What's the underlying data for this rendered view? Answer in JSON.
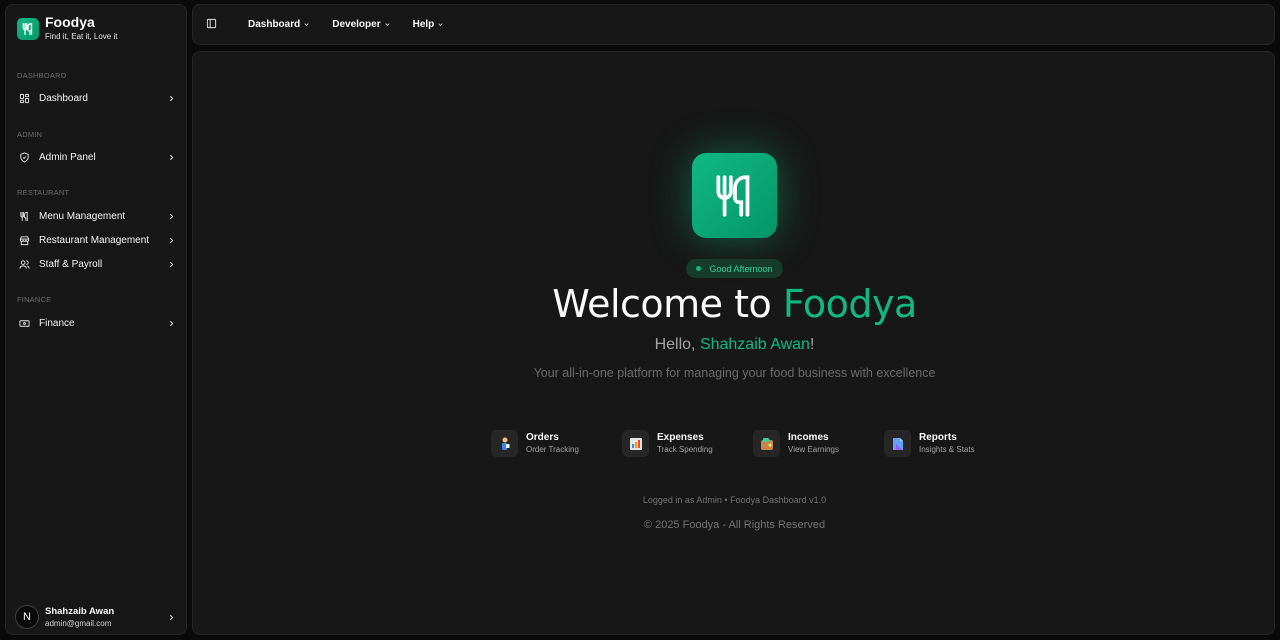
{
  "brand": {
    "name": "Foodya",
    "tagline": "Find it, Eat it, Love it",
    "accent": "#10b981"
  },
  "sidebar": {
    "groups": [
      {
        "label": "DASHBOARD",
        "items": [
          {
            "label": "Dashboard",
            "icon": "grid-icon"
          }
        ]
      },
      {
        "label": "ADMIN",
        "items": [
          {
            "label": "Admin Panel",
            "icon": "shield-check-icon"
          }
        ]
      },
      {
        "label": "RESTAURANT",
        "items": [
          {
            "label": "Menu Management",
            "icon": "utensils-icon"
          },
          {
            "label": "Restaurant Management",
            "icon": "store-icon"
          },
          {
            "label": "Staff & Payroll",
            "icon": "users-icon"
          }
        ]
      },
      {
        "label": "FINANCE",
        "items": [
          {
            "label": "Finance",
            "icon": "banknote-icon"
          }
        ]
      }
    ],
    "user": {
      "avatar": "N",
      "name": "Shahzaib Awan",
      "email": "admin@gmail.com"
    }
  },
  "topbar": {
    "menus": [
      {
        "label": "Dashboard"
      },
      {
        "label": "Developer"
      },
      {
        "label": "Help"
      }
    ]
  },
  "main": {
    "greeting_badge": "Good Afternoon",
    "welcome_prefix": "Welcome to ",
    "welcome_brand": "Foodya",
    "hello_prefix": "Hello, ",
    "hello_name": "Shahzaib Awan",
    "hello_suffix": "!",
    "subtitle": "Your all-in-one platform for managing your food business with excellence",
    "features": [
      {
        "title": "Orders",
        "subtitle": "Order Tracking",
        "icon": "orders-icon"
      },
      {
        "title": "Expenses",
        "subtitle": "Track Spending",
        "icon": "expenses-icon"
      },
      {
        "title": "Incomes",
        "subtitle": "View Earnings",
        "icon": "incomes-icon"
      },
      {
        "title": "Reports",
        "subtitle": "Insights & Stats",
        "icon": "reports-icon"
      }
    ],
    "footer_line": "Logged in as Admin • Foodya Dashboard v1.0",
    "copyright": "© 2025 Foodya - All Rights Reserved"
  }
}
